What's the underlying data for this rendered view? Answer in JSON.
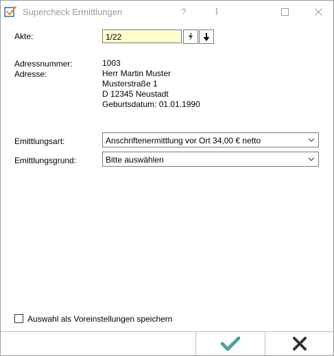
{
  "window": {
    "title": "Supercheck Ermittlungen",
    "help_glyph": "?",
    "cursor_glyph": "I",
    "maximize_glyph": "☐",
    "close_glyph": "✕"
  },
  "akte": {
    "label": "Akte:",
    "value": "1/22"
  },
  "address": {
    "number_label": "Adressnummer:",
    "number_value": "1003",
    "address_label": "Adresse:",
    "lines": [
      "Herr Martin Muster",
      "Musterstraße 1",
      "D 12345 Neustadt",
      "Geburtsdatum: 01.01.1990"
    ]
  },
  "form": {
    "art_label": "Emittlungsart:",
    "art_value": "Anschriftenermittlung vor Ort 34,00 € netto",
    "grund_label": "Emittlungsgrund:",
    "grund_value": "Bitte auswählen"
  },
  "options": {
    "save_defaults_label": "Auswahl als Voreinstellungen speichern"
  },
  "colors": {
    "accent_check": "#4aa3a0",
    "akte_bg": "#ffffcc",
    "icon_blue": "#2f78c4",
    "icon_orange": "#f08a24"
  },
  "icons": {
    "app": "checkbox-check-icon",
    "akte_search": "lightning-icon",
    "akte_down": "arrow-down-icon",
    "ok": "checkmark-icon",
    "cancel": "x-icon"
  }
}
